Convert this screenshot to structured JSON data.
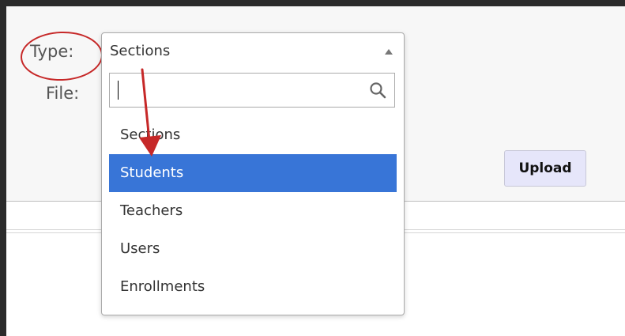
{
  "form": {
    "type_label": "Type:",
    "file_label": "File:",
    "upload_label": "Upload"
  },
  "dropdown": {
    "selected_value": "Sections",
    "search_value": "",
    "options": [
      {
        "label": "Sections",
        "highlighted": false
      },
      {
        "label": "Students",
        "highlighted": true
      },
      {
        "label": "Teachers",
        "highlighted": false
      },
      {
        "label": "Users",
        "highlighted": false
      },
      {
        "label": "Enrollments",
        "highlighted": false
      }
    ]
  },
  "colors": {
    "highlight": "#3875d7",
    "annotation": "#c62828",
    "upload_bg": "#e6e6fa"
  },
  "icons": {
    "search": "search-icon",
    "chevron": "chevron-up-icon"
  }
}
